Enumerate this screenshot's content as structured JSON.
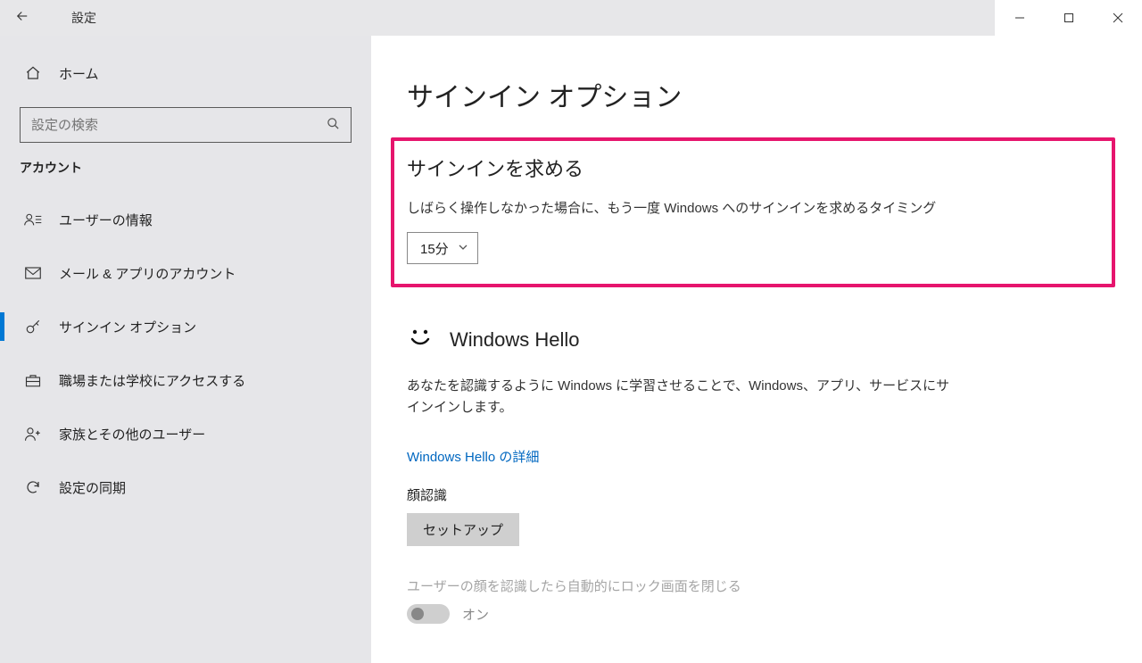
{
  "window": {
    "title": "設定"
  },
  "sidebar": {
    "home": "ホーム",
    "search_placeholder": "設定の検索",
    "group": "アカウント",
    "items": [
      {
        "label": "ユーザーの情報"
      },
      {
        "label": "メール & アプリのアカウント"
      },
      {
        "label": "サインイン オプション"
      },
      {
        "label": "職場または学校にアクセスする"
      },
      {
        "label": "家族とその他のユーザー"
      },
      {
        "label": "設定の同期"
      }
    ]
  },
  "main": {
    "page_title": "サインイン オプション",
    "require_signin": {
      "heading": "サインインを求める",
      "desc": "しばらく操作しなかった場合に、もう一度 Windows へのサインインを求めるタイミング",
      "selected": "15分"
    },
    "hello": {
      "title": "Windows Hello",
      "desc": "あなたを認識するように Windows に学習させることで、Windows、アプリ、サービスにサインインします。",
      "link": "Windows Hello の詳細",
      "face_label": "顔認識",
      "setup_button": "セットアップ",
      "auto_close_desc": "ユーザーの顔を認識したら自動的にロック画面を閉じる",
      "toggle_label": "オン"
    }
  }
}
